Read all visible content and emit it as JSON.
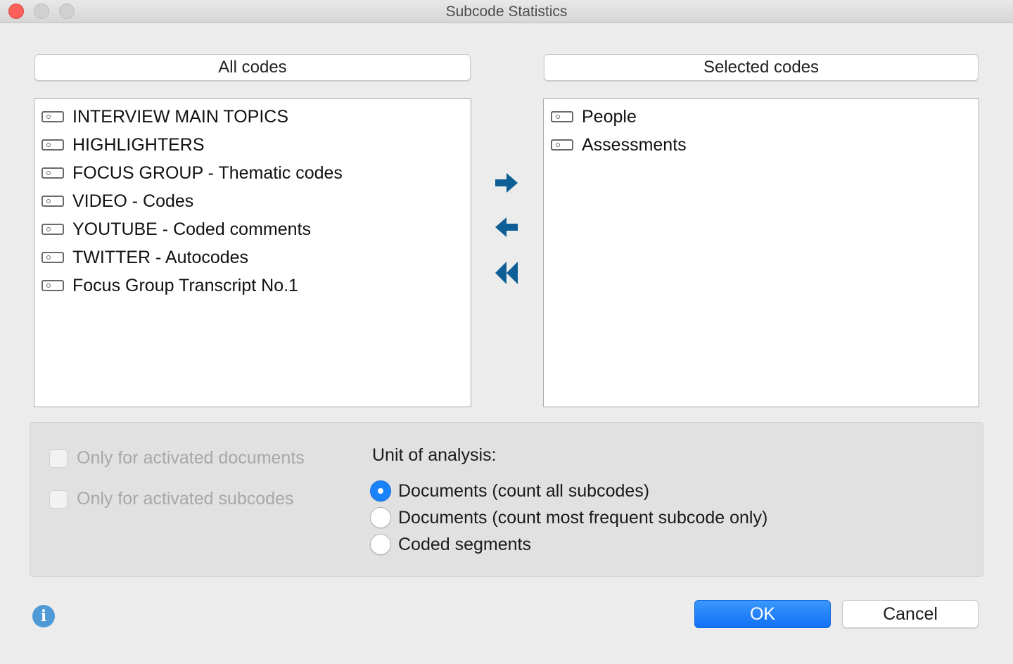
{
  "window": {
    "title": "Subcode Statistics"
  },
  "left_list": {
    "header": "All codes",
    "items": [
      "INTERVIEW MAIN TOPICS",
      "HIGHLIGHTERS",
      "FOCUS GROUP - Thematic codes",
      "VIDEO - Codes",
      "YOUTUBE - Coded comments",
      "TWITTER - Autocodes",
      "Focus Group Transcript No.1"
    ]
  },
  "right_list": {
    "header": "Selected codes",
    "items": [
      "People",
      "Assessments"
    ]
  },
  "transfer_buttons": {
    "add": "arrow-right-icon",
    "remove": "arrow-left-icon",
    "remove_all": "double-arrow-left-icon",
    "color": "#0e5f95"
  },
  "options": {
    "only_activated_documents": {
      "label": "Only for activated documents",
      "checked": false,
      "enabled": false
    },
    "only_activated_subcodes": {
      "label": "Only for activated subcodes",
      "checked": false,
      "enabled": false
    }
  },
  "unit_of_analysis": {
    "label": "Unit of analysis:",
    "options": [
      {
        "label": "Documents (count all subcodes)",
        "selected": true
      },
      {
        "label": "Documents (count most frequent subcode only)",
        "selected": false
      },
      {
        "label": "Coded segments",
        "selected": false
      }
    ]
  },
  "buttons": {
    "ok": "OK",
    "cancel": "Cancel"
  },
  "icons": {
    "info": "info-icon"
  },
  "colors": {
    "accent": "#1a82fb",
    "arrow": "#0e5f95",
    "close": "#fc605b"
  }
}
